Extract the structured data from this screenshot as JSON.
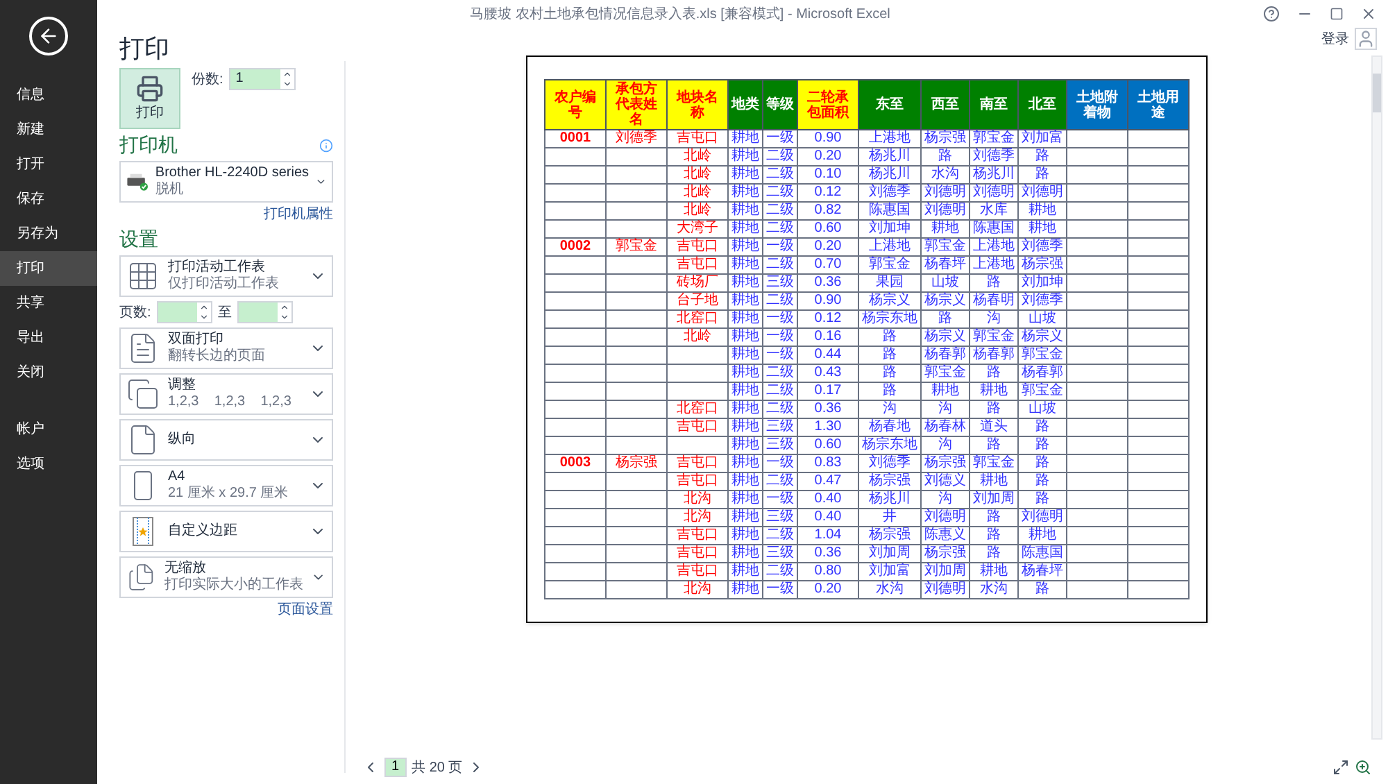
{
  "window": {
    "title": "马腰坡 农村土地承包情况信息录入表.xls [兼容模式] - Microsoft Excel",
    "account": "登录"
  },
  "sidebar": {
    "items": [
      {
        "label": "信息",
        "selected": false
      },
      {
        "label": "新建",
        "selected": false
      },
      {
        "label": "打开",
        "selected": false
      },
      {
        "label": "保存",
        "selected": false
      },
      {
        "label": "另存为",
        "selected": false
      },
      {
        "label": "打印",
        "selected": true
      },
      {
        "label": "共享",
        "selected": false
      },
      {
        "label": "导出",
        "selected": false
      },
      {
        "label": "关闭",
        "selected": false
      }
    ],
    "bottom_items": [
      {
        "label": "帐户",
        "selected": false
      },
      {
        "label": "选项",
        "selected": false
      }
    ]
  },
  "print": {
    "heading": "打印",
    "button": "打印",
    "copies_label": "份数:",
    "copies_value": "1"
  },
  "printer": {
    "heading": "打印机",
    "name": "Brother HL-2240D series",
    "status": "脱机",
    "properties_link": "打印机属性"
  },
  "settings": {
    "heading": "设置",
    "pages_label": "页数:",
    "to_label": "至",
    "page_setup_link": "页面设置",
    "options": [
      {
        "kind": "sheet",
        "title": "打印活动工作表",
        "subtitle": "仅打印活动工作表"
      },
      {
        "kind": "duplex",
        "title": "双面打印",
        "subtitle": "翻转长边的页面"
      },
      {
        "kind": "collate",
        "title": "调整",
        "subtitle": "1,2,3    1,2,3    1,2,3"
      },
      {
        "kind": "orientation",
        "title": "纵向"
      },
      {
        "kind": "paper",
        "title": "A4",
        "subtitle": "21 厘米 x 29.7 厘米"
      },
      {
        "kind": "margins",
        "title": "自定义边距"
      },
      {
        "kind": "scaling",
        "title": "无缩放",
        "subtitle": "打印实际大小的工作表"
      }
    ]
  },
  "preview": {
    "table": {
      "columns": [
        {
          "label": "农户编号",
          "color": "#ffff00",
          "kind": "key"
        },
        {
          "label": "承包方代表姓名",
          "color": "#ffff00",
          "kind": "key"
        },
        {
          "label": "地块名称",
          "color": "#ffff00",
          "kind": "key"
        },
        {
          "label": "地类",
          "color": "#008000",
          "kind": "attribute"
        },
        {
          "label": "等级",
          "color": "#008000",
          "kind": "attribute"
        },
        {
          "label": "二轮承包面积",
          "color": "#ffff00",
          "kind": "measure"
        },
        {
          "label": "东至",
          "color": "#008000",
          "kind": "attribute"
        },
        {
          "label": "西至",
          "color": "#008000",
          "kind": "attribute"
        },
        {
          "label": "南至",
          "color": "#008000",
          "kind": "attribute"
        },
        {
          "label": "北至",
          "color": "#008000",
          "kind": "attribute"
        },
        {
          "label": "土地附着物",
          "color": "#0070c0",
          "kind": "attribute"
        },
        {
          "label": "土地用途",
          "color": "#0070c0",
          "kind": "attribute"
        }
      ],
      "rows": [
        [
          "0001",
          "刘德季",
          "吉屯口",
          "耕地",
          "一级",
          "0.90",
          "上港地",
          "杨宗强",
          "郭宝金",
          "刘加富",
          null,
          null
        ],
        [
          null,
          null,
          "北岭",
          "耕地",
          "二级",
          "0.20",
          "杨兆川",
          "路",
          "刘德季",
          "路",
          null,
          null
        ],
        [
          null,
          null,
          "北岭",
          "耕地",
          "二级",
          "0.10",
          "杨兆川",
          "水沟",
          "杨兆川",
          "路",
          null,
          null
        ],
        [
          null,
          null,
          "北岭",
          "耕地",
          "二级",
          "0.12",
          "刘德季",
          "刘德明",
          "刘德明",
          "刘德明",
          null,
          null
        ],
        [
          null,
          null,
          "北岭",
          "耕地",
          "二级",
          "0.82",
          "陈惠国",
          "刘德明",
          "水库",
          "耕地",
          null,
          null
        ],
        [
          null,
          null,
          "大湾子",
          "耕地",
          "二级",
          "0.60",
          "刘加坤",
          "耕地",
          "陈惠国",
          "耕地",
          null,
          null
        ],
        [
          "0002",
          "郭宝金",
          "吉屯口",
          "耕地",
          "一级",
          "0.20",
          "上港地",
          "郭宝金",
          "上港地",
          "刘德季",
          null,
          null
        ],
        [
          null,
          null,
          "吉屯口",
          "耕地",
          "二级",
          "0.70",
          "郭宝金",
          "杨春坪",
          "上港地",
          "杨宗强",
          null,
          null
        ],
        [
          null,
          null,
          "砖场厂",
          "耕地",
          "三级",
          "0.36",
          "果园",
          "山坡",
          "路",
          "刘加坤",
          null,
          null
        ],
        [
          null,
          null,
          "台子地",
          "耕地",
          "二级",
          "0.90",
          "杨宗义",
          "杨宗义",
          "杨春明",
          "刘德季",
          null,
          null
        ],
        [
          null,
          null,
          "北窑口",
          "耕地",
          "一级",
          "0.12",
          "杨宗东地",
          "路",
          "沟",
          "山坡",
          null,
          null
        ],
        [
          null,
          null,
          "北岭",
          "耕地",
          "一级",
          "0.16",
          "路",
          "杨宗义",
          "郭宝金",
          "杨宗义",
          null,
          null
        ],
        [
          null,
          null,
          null,
          "耕地",
          "一级",
          "0.44",
          "路",
          "杨春郭",
          "杨春郭",
          "郭宝金",
          null,
          null
        ],
        [
          null,
          null,
          null,
          "耕地",
          "二级",
          "0.43",
          "路",
          "郭宝金",
          "路",
          "杨春郭",
          null,
          null
        ],
        [
          null,
          null,
          null,
          "耕地",
          "二级",
          "0.17",
          "路",
          "耕地",
          "耕地",
          "郭宝金",
          null,
          null
        ],
        [
          null,
          null,
          "北窑口",
          "耕地",
          "二级",
          "0.36",
          "沟",
          "沟",
          "路",
          "山坡",
          null,
          null
        ],
        [
          null,
          null,
          "吉屯口",
          "耕地",
          "三级",
          "1.30",
          "杨春地",
          "杨春林",
          "道头",
          "路",
          null,
          null
        ],
        [
          null,
          null,
          null,
          "耕地",
          "三级",
          "0.60",
          "杨宗东地",
          "沟",
          "路",
          "路",
          null,
          null
        ],
        [
          "0003",
          "杨宗强",
          "吉屯口",
          "耕地",
          "一级",
          "0.83",
          "刘德季",
          "杨宗强",
          "郭宝金",
          "路",
          null,
          null
        ],
        [
          null,
          null,
          "吉屯口",
          "耕地",
          "二级",
          "0.47",
          "杨宗强",
          "刘德义",
          "耕地",
          "路",
          null,
          null
        ],
        [
          null,
          null,
          "北沟",
          "耕地",
          "一级",
          "0.40",
          "杨兆川",
          "沟",
          "刘加周",
          "路",
          null,
          null
        ],
        [
          null,
          null,
          "北沟",
          "耕地",
          "三级",
          "0.40",
          "井",
          "刘德明",
          "路",
          "刘德明",
          null,
          null
        ],
        [
          null,
          null,
          "吉屯口",
          "耕地",
          "二级",
          "1.04",
          "杨宗强",
          "陈惠义",
          "路",
          "耕地",
          null,
          null
        ],
        [
          null,
          null,
          "吉屯口",
          "耕地",
          "三级",
          "0.36",
          "刘加周",
          "杨宗强",
          "路",
          "陈惠国",
          null,
          null
        ],
        [
          null,
          null,
          "吉屯口",
          "耕地",
          "二级",
          "0.80",
          "刘加富",
          "刘加周",
          "耕地",
          "杨春坪",
          null,
          null
        ],
        [
          null,
          null,
          "北沟",
          "耕地",
          "一级",
          "0.20",
          "水沟",
          "刘德明",
          "水沟",
          "路",
          null,
          null
        ]
      ]
    },
    "pager": {
      "current": "1",
      "total": "共 20 页"
    }
  }
}
